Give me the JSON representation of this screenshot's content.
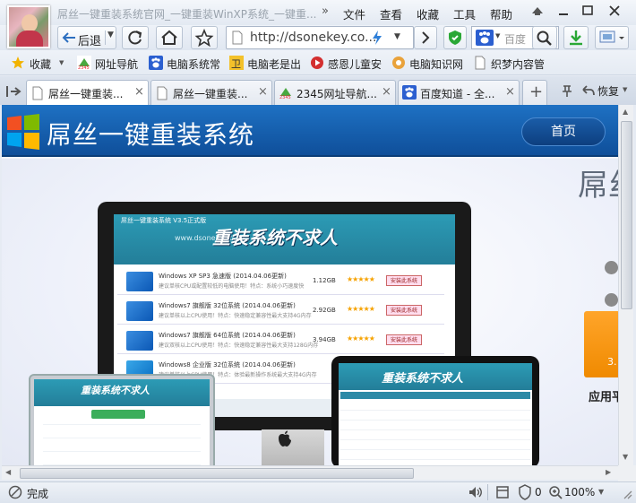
{
  "window": {
    "title": "屌丝一键重装系统官网_一键重装WinXP系统_一键重...",
    "menu": [
      "文件",
      "查看",
      "收藏",
      "工具",
      "帮助"
    ]
  },
  "toolbar": {
    "back_label": "后退",
    "address": "http://dsonekey.co...",
    "search_placeholder": "百度"
  },
  "favorites": {
    "collect_label": "收藏",
    "items": [
      "网址导航",
      "电脑系统常",
      "电脑老是出",
      "感恩儿童安",
      "电脑知识网",
      "织梦内容管"
    ]
  },
  "tabs": [
    {
      "label": "屌丝一键重装..."
    },
    {
      "label": "屌丝一键重装..."
    },
    {
      "label": "2345网址导航..."
    },
    {
      "label": "百度知道 - 全..."
    }
  ],
  "tabbar": {
    "restore_label": "恢复"
  },
  "page": {
    "site_title": "屌丝一键重装系统",
    "home_button": "首页",
    "right_title": "屌丝",
    "orange_text": "3.",
    "app_label": "应用平",
    "app": {
      "name": "屌丝一键重装系统 V3.5正式版",
      "slogan": "重装系统不求人",
      "url": "www.dsonekey.com",
      "rows": [
        {
          "title": "Windows XP SP3 急速版 (2014.04.06更新)",
          "sub": "建议单核CPU或配置较低的电脑使用！特点：系统小巧速度快",
          "size": "1.12GB",
          "stars": "★★★★★",
          "button": "安装此系统"
        },
        {
          "title": "Windows7 旗舰版 32位系统 (2014.04.06更新)",
          "sub": "建议单核以上CPU使用！特点：快速稳定兼容性最大支持4G内存",
          "size": "2.92GB",
          "stars": "★★★★★",
          "button": "安装此系统"
        },
        {
          "title": "Windows7 旗舰版 64位系统 (2014.04.06更新)",
          "sub": "建议双核以上CPU使用！特点：快速稳定兼容性最大支持128G内存",
          "size": "3.94GB",
          "stars": "★★★★★",
          "button": "安装此系统"
        },
        {
          "title": "Windows8 企业版 32位系统 (2014.04.06更新)",
          "sub": "建议单核以上CPU使用！特点：体验最新操作系统最大支持4G内存",
          "size": "",
          "stars": "",
          "button": ""
        }
      ],
      "laptop_slogan": "重装系统不求人",
      "tablet_slogan": "重装系统不求人"
    }
  },
  "status": {
    "text": "完成",
    "count": "0",
    "zoom": "100%"
  }
}
